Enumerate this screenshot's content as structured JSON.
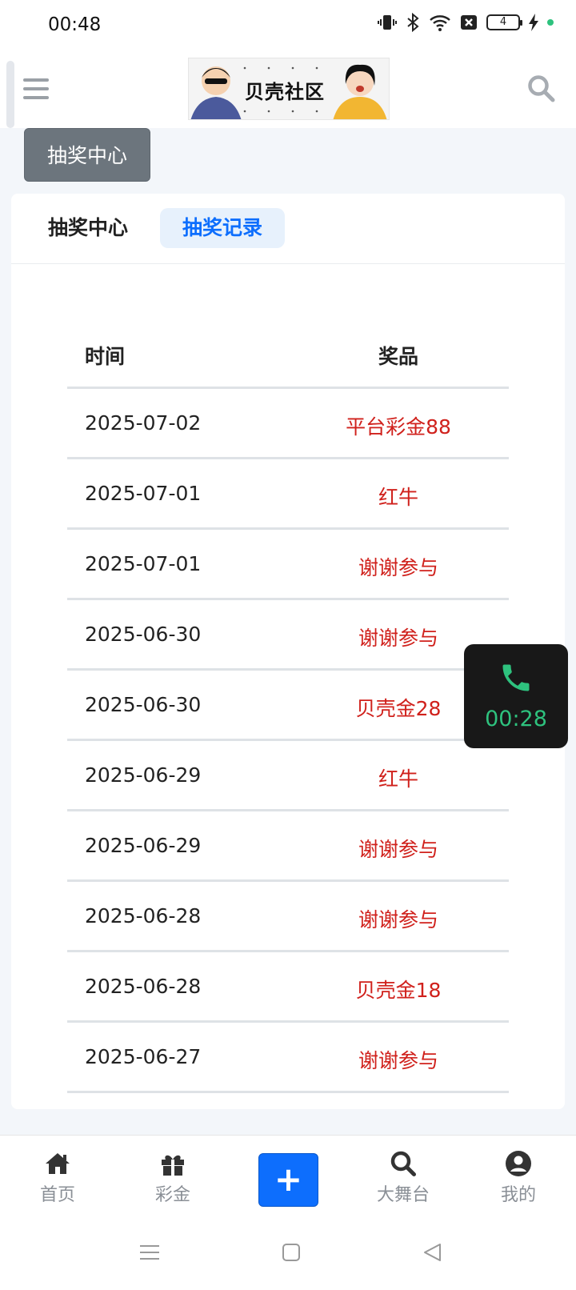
{
  "status_bar": {
    "time": "00:48",
    "battery": "4"
  },
  "header": {
    "logo_text": "贝壳社区"
  },
  "chip_label": "抽奖中心",
  "tabs": [
    {
      "label": "抽奖中心"
    },
    {
      "label": "抽奖记录"
    }
  ],
  "table": {
    "headers": {
      "time": "时间",
      "prize": "奖品"
    },
    "rows": [
      {
        "date": "2025-07-02",
        "prize": "平台彩金88"
      },
      {
        "date": "2025-07-01",
        "prize": "红牛"
      },
      {
        "date": "2025-07-01",
        "prize": "谢谢参与"
      },
      {
        "date": "2025-06-30",
        "prize": "谢谢参与"
      },
      {
        "date": "2025-06-30",
        "prize": "贝壳金28"
      },
      {
        "date": "2025-06-29",
        "prize": "红牛"
      },
      {
        "date": "2025-06-29",
        "prize": "谢谢参与"
      },
      {
        "date": "2025-06-28",
        "prize": "谢谢参与"
      },
      {
        "date": "2025-06-28",
        "prize": "贝壳金18"
      },
      {
        "date": "2025-06-27",
        "prize": "谢谢参与"
      }
    ]
  },
  "call_float": {
    "timer": "00:28"
  },
  "bottom_nav": [
    {
      "label": "首页",
      "icon": "home-icon"
    },
    {
      "label": "彩金",
      "icon": "gift-icon"
    },
    {
      "label": "",
      "icon": "plus-icon"
    },
    {
      "label": "大舞台",
      "icon": "search-icon"
    },
    {
      "label": "我的",
      "icon": "user-circle-icon"
    }
  ],
  "colors": {
    "accent": "#0d6efd",
    "prize_red": "#d0211c",
    "call_green": "#2ec27e"
  }
}
